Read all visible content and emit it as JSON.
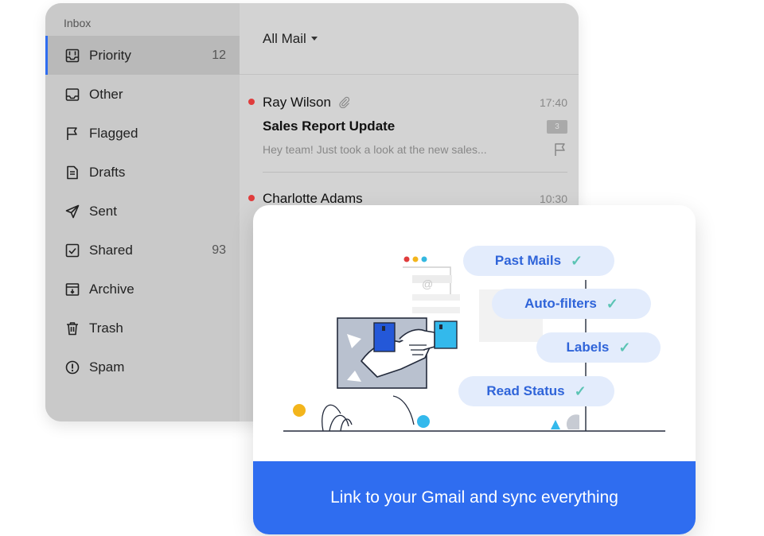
{
  "mail": {
    "inbox_heading": "Inbox",
    "folders": [
      {
        "label": "Priority",
        "count": "12",
        "icon": "priority-inbox-icon"
      },
      {
        "label": "Other",
        "count": "",
        "icon": "inbox-tray-icon"
      },
      {
        "label": "Flagged",
        "count": "",
        "icon": "flag-icon"
      },
      {
        "label": "Drafts",
        "count": "",
        "icon": "draft-document-icon"
      },
      {
        "label": "Sent",
        "count": "",
        "icon": "send-icon"
      },
      {
        "label": "Shared",
        "count": "93",
        "icon": "shared-icon"
      },
      {
        "label": "Archive",
        "count": "",
        "icon": "archive-box-icon"
      },
      {
        "label": "Trash",
        "count": "",
        "icon": "trash-icon"
      },
      {
        "label": "Spam",
        "count": "",
        "icon": "spam-warning-icon"
      }
    ],
    "filter_label": "All Mail",
    "messages": [
      {
        "sender": "Ray Wilson",
        "time": "17:40",
        "subject": "Sales Report Update",
        "preview": "Hey team! Just took a look at the new sales...",
        "badge": "3",
        "has_attachment": true
      },
      {
        "sender": "Charlotte Adams",
        "time": "10:30"
      }
    ]
  },
  "sync_card": {
    "features": [
      {
        "label": "Past Mails",
        "icon": "check-icon"
      },
      {
        "label": "Auto-filters",
        "icon": "check-icon"
      },
      {
        "label": "Labels",
        "icon": "check-icon"
      },
      {
        "label": "Read Status",
        "icon": "check-icon"
      }
    ],
    "cta_label": "Link to your Gmail and sync everything"
  },
  "colors": {
    "accent": "#2f6df0",
    "pill_bg": "#e3ecfc",
    "pill_text": "#2f64d9",
    "check": "#5bc4b4",
    "unread_dot": "#e03c3c",
    "window_bg": "#d0d0d0"
  }
}
